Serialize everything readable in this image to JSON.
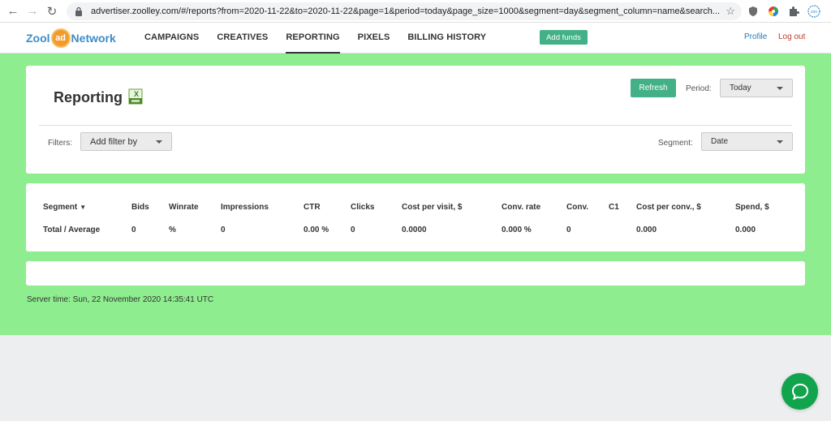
{
  "browser": {
    "url": "advertiser.zoolley.com/#/reports?from=2020-11-22&to=2020-11-22&page=1&period=today&page_size=1000&segment=day&segment_column=name&search..."
  },
  "header": {
    "logo": {
      "left": "Zool",
      "badge": "ad",
      "right": "Network"
    },
    "nav": [
      {
        "label": "CAMPAIGNS"
      },
      {
        "label": "CREATIVES"
      },
      {
        "label": "REPORTING"
      },
      {
        "label": "PIXELS"
      },
      {
        "label": "BILLING HISTORY"
      }
    ],
    "active_nav": "REPORTING",
    "add_funds": "Add funds",
    "profile": "Profile",
    "logout": "Log out"
  },
  "report": {
    "title": "Reporting",
    "refresh": "Refresh",
    "period_label": "Period:",
    "period_value": "Today",
    "filters_label": "Filters:",
    "filter_placeholder": "Add filter by",
    "segment_label": "Segment:",
    "segment_value": "Date"
  },
  "table": {
    "columns": [
      "Segment",
      "Bids",
      "Winrate",
      "Impressions",
      "CTR",
      "Clicks",
      "Cost per visit, $",
      "Conv. rate",
      "Conv.",
      "C1",
      "Cost per conv., $",
      "Spend, $"
    ],
    "sort_indicator": "▼",
    "total_row": [
      "Total / Average",
      "0",
      "%",
      "0",
      "0.00 %",
      "0",
      "0.0000",
      "0.000 %",
      "0",
      "",
      "0.000",
      "0.000"
    ]
  },
  "footer": {
    "server_time": "Server time: Sun, 22 November 2020 14:35:41 UTC"
  },
  "colors": {
    "brand_green": "#43b087",
    "page_green": "#8eed8e",
    "chat_green": "#12a34d"
  }
}
